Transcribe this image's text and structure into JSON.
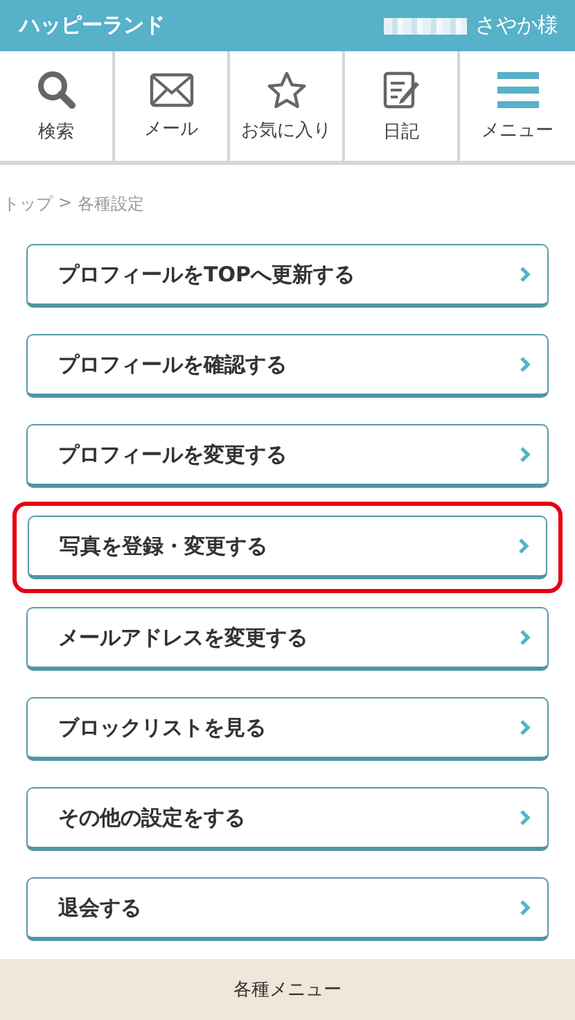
{
  "header": {
    "title": "ハッピーランド",
    "user_name": "さやか様"
  },
  "nav": [
    {
      "kind": "search",
      "label": "検索"
    },
    {
      "kind": "mail",
      "label": "メール"
    },
    {
      "kind": "star",
      "label": "お気に入り"
    },
    {
      "kind": "diary",
      "label": "日記"
    },
    {
      "kind": "menu",
      "label": "メニュー"
    }
  ],
  "breadcrumb": [
    "トップ",
    "各種設定"
  ],
  "breadcrumb_separator": ">",
  "menu_items": [
    {
      "label": "プロフィールをTOPへ更新する",
      "highlighted": false
    },
    {
      "label": "プロフィールを確認する",
      "highlighted": false
    },
    {
      "label": "プロフィールを変更する",
      "highlighted": false
    },
    {
      "label": "写真を登録・変更する",
      "highlighted": true
    },
    {
      "label": "メールアドレスを変更する",
      "highlighted": false
    },
    {
      "label": "ブロックリストを見る",
      "highlighted": false
    },
    {
      "label": "その他の設定をする",
      "highlighted": false
    },
    {
      "label": "退会する",
      "highlighted": false
    }
  ],
  "footer": {
    "label": "各種メニュー"
  }
}
